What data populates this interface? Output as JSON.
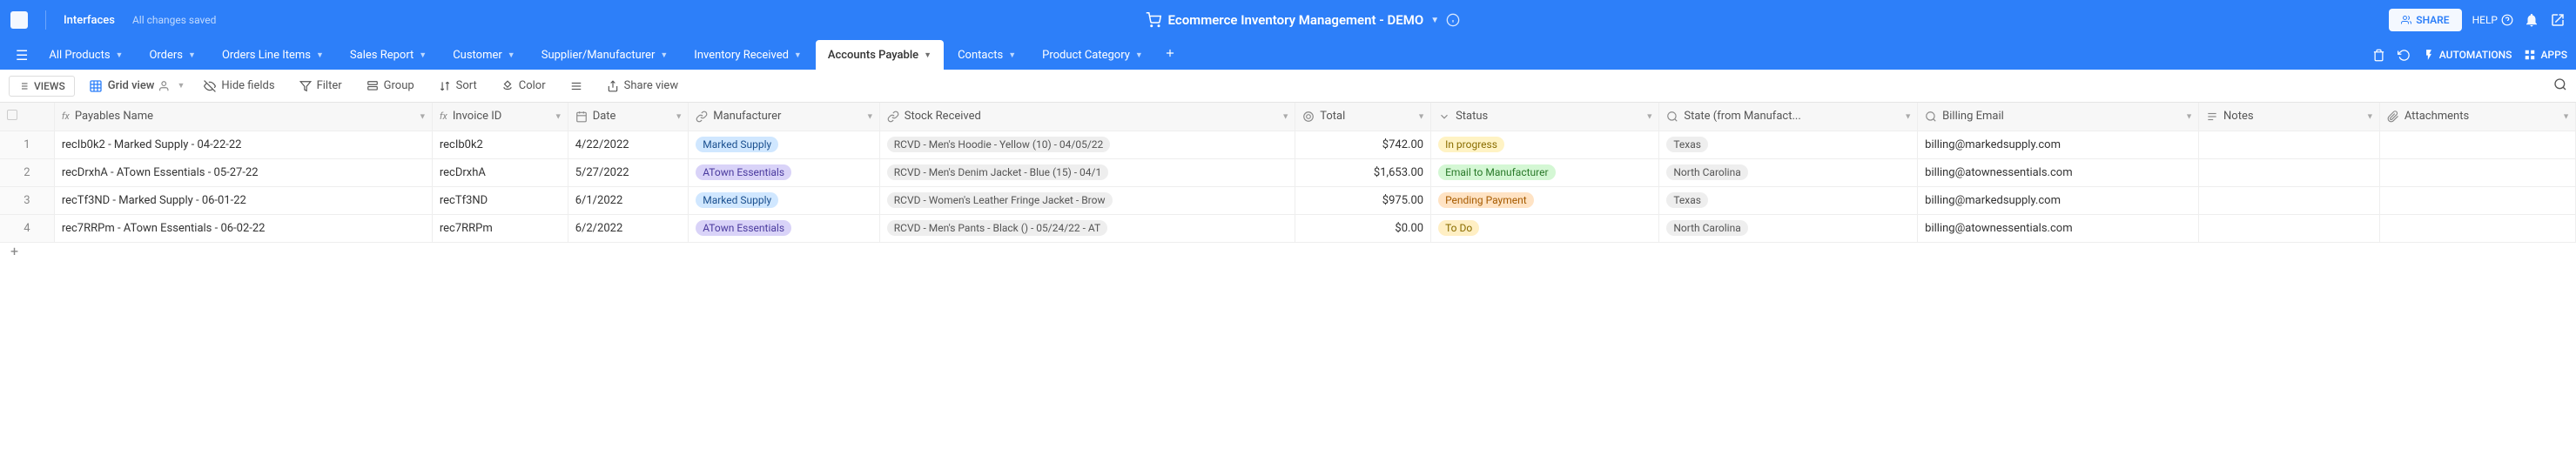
{
  "topbar": {
    "interfaces": "Interfaces",
    "changes_saved": "All changes saved",
    "title": "Ecommerce Inventory Management - DEMO",
    "share": "SHARE",
    "help": "HELP"
  },
  "tabs": {
    "items": [
      {
        "label": "All Products"
      },
      {
        "label": "Orders"
      },
      {
        "label": "Orders Line Items"
      },
      {
        "label": "Sales Report"
      },
      {
        "label": "Customer"
      },
      {
        "label": "Supplier/Manufacturer"
      },
      {
        "label": "Inventory Received"
      },
      {
        "label": "Accounts Payable"
      },
      {
        "label": "Contacts"
      },
      {
        "label": "Product Category"
      }
    ],
    "active_index": 7,
    "right": {
      "automations": "AUTOMATIONS",
      "apps": "APPS"
    }
  },
  "viewbar": {
    "views": "VIEWS",
    "grid_view": "Grid view",
    "hide_fields": "Hide fields",
    "filter": "Filter",
    "group": "Group",
    "sort": "Sort",
    "color": "Color",
    "share_view": "Share view"
  },
  "columns": [
    {
      "label": "Payables Name",
      "icon": "fx"
    },
    {
      "label": "Invoice ID",
      "icon": "fx"
    },
    {
      "label": "Date",
      "icon": "calendar"
    },
    {
      "label": "Manufacturer",
      "icon": "link"
    },
    {
      "label": "Stock Received",
      "icon": "link"
    },
    {
      "label": "Total",
      "icon": "rollup"
    },
    {
      "label": "Status",
      "icon": "select"
    },
    {
      "label": "State (from Manufact...",
      "icon": "lookup"
    },
    {
      "label": "Billing Email",
      "icon": "lookup"
    },
    {
      "label": "Notes",
      "icon": "text"
    },
    {
      "label": "Attachments",
      "icon": "attachment"
    }
  ],
  "rows": [
    {
      "num": "1",
      "name": "recIb0k2 - Marked Supply - 04-22-22",
      "invoice": "recIb0k2",
      "date": "4/22/2022",
      "mfr": "Marked Supply",
      "mfr_class": "pill-mfr-1",
      "stock": "RCVD - Men's Hoodie - Yellow (10) - 04/05/22",
      "total": "$742.00",
      "status": "In progress",
      "status_class": "pill-status-prog",
      "state": "Texas",
      "email": "billing@markedsupply.com"
    },
    {
      "num": "2",
      "name": "recDrxhA - ATown Essentials - 05-27-22",
      "invoice": "recDrxhA",
      "date": "5/27/2022",
      "mfr": "ATown Essentials",
      "mfr_class": "pill-mfr-2",
      "stock": "RCVD - Men's Denim Jacket - Blue (15) - 04/1",
      "total": "$1,653.00",
      "status": "Email to Manufacturer",
      "status_class": "pill-status-email",
      "state": "North Carolina",
      "email": "billing@atownessentials.com"
    },
    {
      "num": "3",
      "name": "recTf3ND - Marked Supply - 06-01-22",
      "invoice": "recTf3ND",
      "date": "6/1/2022",
      "mfr": "Marked Supply",
      "mfr_class": "pill-mfr-1",
      "stock": "RCVD - Women's Leather Fringe Jacket - Brow",
      "total": "$975.00",
      "status": "Pending Payment",
      "status_class": "pill-status-pend",
      "state": "Texas",
      "email": "billing@markedsupply.com"
    },
    {
      "num": "4",
      "name": "rec7RRPm - ATown Essentials - 06-02-22",
      "invoice": "rec7RRPm",
      "date": "6/2/2022",
      "mfr": "ATown Essentials",
      "mfr_class": "pill-mfr-2",
      "stock": "RCVD - Men's Pants - Black () - 05/24/22 - AT",
      "total": "$0.00",
      "status": "To Do",
      "status_class": "pill-status-todo",
      "state": "North Carolina",
      "email": "billing@atownessentials.com"
    }
  ]
}
